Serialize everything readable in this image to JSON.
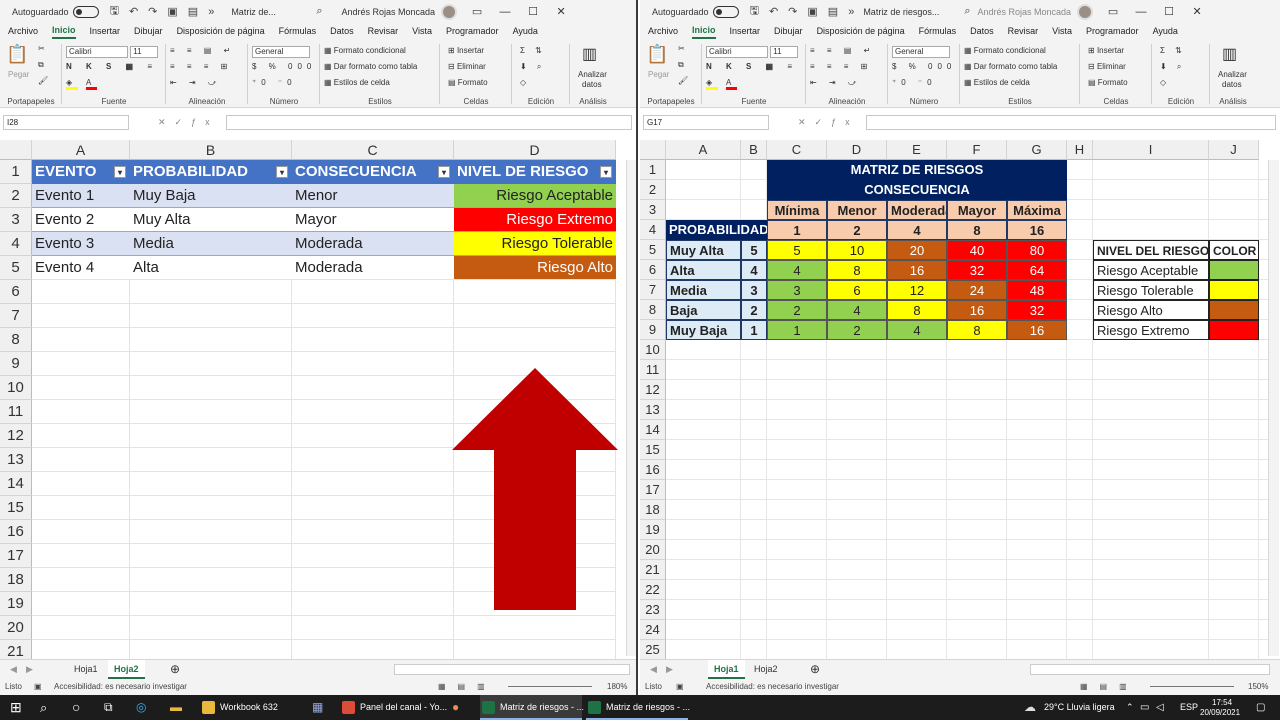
{
  "left": {
    "titlebar": {
      "autosave": "Autoguardado",
      "doc": "Matriz de...",
      "user": "Andrés Rojas Moncada"
    },
    "menu": [
      "Archivo",
      "Inicio",
      "Insertar",
      "Dibujar",
      "Disposición de página",
      "Fórmulas",
      "Datos",
      "Revisar",
      "Vista",
      "Programador",
      "Ayuda"
    ],
    "ribbon": {
      "pegar": "Pegar",
      "portapapeles": "Portapapeles",
      "font_name": "Calibri",
      "font_size": "11",
      "fuente": "Fuente",
      "alineacion": "Alineación",
      "number_format": "General",
      "numero": "Número",
      "formato_condicional": "Formato condicional",
      "dar_formato": "Dar formato como tabla",
      "estilos_celda": "Estilos de celda",
      "estilos": "Estilos",
      "insertar": "Insertar",
      "eliminar": "Eliminar",
      "formato": "Formato",
      "celdas": "Celdas",
      "edicion": "Edición",
      "analizar1": "Analizar",
      "analizar2": "datos",
      "analisis": "Análisis"
    },
    "name_box": "I28",
    "columns": [
      "A",
      "B",
      "C",
      "D"
    ],
    "rows": [
      "1",
      "2",
      "3",
      "4",
      "5",
      "6",
      "7",
      "8",
      "9",
      "10",
      "11",
      "12",
      "13",
      "14",
      "15",
      "16",
      "17",
      "18",
      "19",
      "20",
      "21"
    ],
    "table": {
      "headers": [
        "EVENTO",
        "PROBABILIDAD",
        "CONSECUENCIA",
        "NIVEL DE RIESGO"
      ],
      "rows": [
        [
          "Evento 1",
          "Muy Baja",
          "Menor",
          "Riesgo Aceptable"
        ],
        [
          "Evento 2",
          "Muy Alta",
          "Mayor",
          "Riesgo Extremo"
        ],
        [
          "Evento 3",
          "Media",
          "Moderada",
          "Riesgo Tolerable"
        ],
        [
          "Evento 4",
          "Alta",
          "Moderada",
          "Riesgo Alto"
        ]
      ],
      "level_colors": [
        "#92d050",
        "#ff0000",
        "#ffff00",
        "#c55a11"
      ],
      "level_text_colors": [
        "#222222",
        "#ffffff",
        "#222222",
        "#ffffff"
      ]
    },
    "sheets": [
      "Hoja1",
      "Hoja2"
    ],
    "active_sheet": "Hoja2",
    "status": "Listo",
    "accessibility": "Accesibilidad: es necesario investigar",
    "zoom": "180%",
    "arrow_color": "#c00000"
  },
  "right": {
    "titlebar": {
      "autosave": "Autoguardado",
      "doc": "Matriz de riesgos...",
      "user": "Andrés Rojas Moncada"
    },
    "menu": [
      "Archivo",
      "Inicio",
      "Insertar",
      "Dibujar",
      "Disposición de página",
      "Fórmulas",
      "Datos",
      "Revisar",
      "Vista",
      "Programador",
      "Ayuda"
    ],
    "ribbon": {
      "pegar": "Pegar",
      "portapapeles": "Portapapeles",
      "font_name": "Calibri",
      "font_size": "11",
      "fuente": "Fuente",
      "alineacion": "Alineación",
      "number_format": "General",
      "numero": "Número",
      "formato_condicional": "Formato condicional",
      "dar_formato": "Dar formato como tabla",
      "estilos_celda": "Estilos de celda",
      "estilos": "Estilos",
      "insertar": "Insertar",
      "eliminar": "Eliminar",
      "formato": "Formato",
      "celdas": "Celdas",
      "edicion": "Edición",
      "analizar1": "Analizar",
      "analizar2": "datos",
      "analisis": "Análisis"
    },
    "name_box": "G17",
    "columns": [
      "A",
      "B",
      "C",
      "D",
      "E",
      "F",
      "G",
      "H",
      "I",
      "J"
    ],
    "rows": [
      "1",
      "2",
      "3",
      "4",
      "5",
      "6",
      "7",
      "8",
      "9",
      "10",
      "11",
      "12",
      "13",
      "14",
      "15",
      "16",
      "17",
      "18",
      "19",
      "20",
      "21",
      "22",
      "23",
      "24",
      "25"
    ],
    "matrix": {
      "title": "MATRIZ DE RIESGOS",
      "subtitle": "CONSECUENCIA",
      "prob_label": "PROBABILIDAD",
      "cons_labels": [
        "Mínima",
        "Menor",
        "Moderada",
        "Mayor",
        "Máxima"
      ],
      "cons_values": [
        "1",
        "2",
        "4",
        "8",
        "16"
      ],
      "prob_rows": [
        {
          "label": "Muy Alta",
          "value": "5",
          "cells": [
            "5",
            "10",
            "20",
            "40",
            "80"
          ],
          "colors": [
            "#ffff00",
            "#ffff00",
            "#c55a11",
            "#ff0000",
            "#ff0000"
          ]
        },
        {
          "label": "Alta",
          "value": "4",
          "cells": [
            "4",
            "8",
            "16",
            "32",
            "64"
          ],
          "colors": [
            "#92d050",
            "#ffff00",
            "#c55a11",
            "#ff0000",
            "#ff0000"
          ]
        },
        {
          "label": "Media",
          "value": "3",
          "cells": [
            "3",
            "6",
            "12",
            "24",
            "48"
          ],
          "colors": [
            "#92d050",
            "#ffff00",
            "#ffff00",
            "#c55a11",
            "#ff0000"
          ]
        },
        {
          "label": "Baja",
          "value": "2",
          "cells": [
            "2",
            "4",
            "8",
            "16",
            "32"
          ],
          "colors": [
            "#92d050",
            "#92d050",
            "#ffff00",
            "#c55a11",
            "#ff0000"
          ]
        },
        {
          "label": "Muy Baja",
          "value": "1",
          "cells": [
            "1",
            "2",
            "4",
            "8",
            "16"
          ],
          "colors": [
            "#92d050",
            "#92d050",
            "#92d050",
            "#ffff00",
            "#c55a11"
          ]
        }
      ]
    },
    "legend": {
      "headers": [
        "NIVEL DEL RIESGO",
        "COLOR"
      ],
      "rows": [
        {
          "label": "Riesgo Aceptable",
          "color": "#92d050"
        },
        {
          "label": "Riesgo Tolerable",
          "color": "#ffff00"
        },
        {
          "label": "Riesgo Alto",
          "color": "#c55a11"
        },
        {
          "label": "Riesgo Extremo",
          "color": "#ff0000"
        }
      ]
    },
    "sheets": [
      "Hoja1",
      "Hoja2"
    ],
    "active_sheet": "Hoja1",
    "status": "Listo",
    "accessibility": "Accesibilidad: es necesario investigar",
    "zoom": "150%"
  },
  "taskbar": {
    "apps": [
      {
        "label": "Workbook 632",
        "icon": "folder-icon",
        "color": "#e8b93c"
      },
      {
        "label": "Panel del canal - Yo...",
        "icon": "chrome-icon",
        "color": "#dd4b39"
      },
      {
        "label": "Matriz de riesgos - ...",
        "icon": "excel-icon",
        "color": "#1f7244"
      },
      {
        "label": "Matriz de riesgos - ...",
        "icon": "excel-icon",
        "color": "#1f7244"
      }
    ],
    "weather": "29°C  Lluvia ligera",
    "lang": "ESP",
    "time": "17:54",
    "date": "20/09/2021"
  }
}
